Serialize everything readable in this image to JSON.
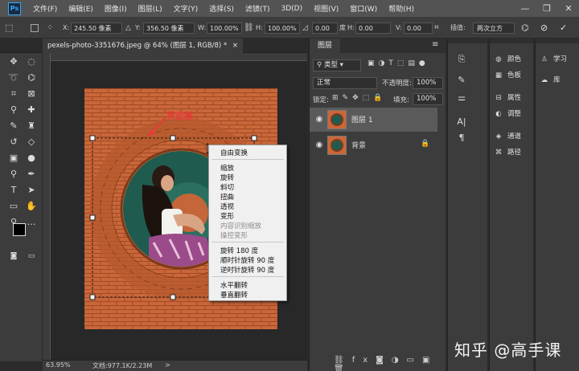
{
  "app": {
    "logo": "Ps"
  },
  "menubar": {
    "items": [
      "文件(F)",
      "编辑(E)",
      "图像(I)",
      "图层(L)",
      "文字(Y)",
      "选择(S)",
      "滤镜(T)",
      "3D(D)",
      "视图(V)",
      "窗口(W)",
      "帮助(H)"
    ],
    "min_icon": "minimize-icon",
    "max_icon": "maximize-icon",
    "close_icon": "close-icon"
  },
  "options_bar": {
    "x_label": "X:",
    "x_value": "245.50 像素",
    "y_label": "Y:",
    "y_value": "356.50 像素",
    "w_label": "W:",
    "w_value": "100.00%",
    "h_label": "H:",
    "h_value": "100.00%",
    "rot_value": "0.00",
    "rot_unit": "度",
    "hskew_label": "H:",
    "hskew_value": "0.00",
    "vskew_label": "V:",
    "vskew_value": "0.00",
    "interp_label": "插值:",
    "interp_value": "两次立方"
  },
  "document": {
    "tab_title": "pexels-photo-3351676.jpeg @ 64% (图层 1, RGB/8) *",
    "tab_close": "×",
    "annotation": "界定框"
  },
  "context_menu": {
    "groups": [
      [
        "自由变换"
      ],
      [
        "缩放",
        "旋转",
        "斜切",
        "扭曲",
        "透视",
        "变形"
      ],
      [
        "内容识别缩放",
        "操控变形"
      ],
      [
        "旋转 180 度",
        "顺时针旋转 90 度",
        "逆时针旋转 90 度"
      ],
      [
        "水平翻转",
        "垂直翻转"
      ]
    ],
    "disabled": [
      "内容识别缩放",
      "操控变形"
    ]
  },
  "status_bar": {
    "zoom": "63.95%",
    "doc_info": "文档:977.1K/2.23M",
    "arrow": ">"
  },
  "layers_panel": {
    "tab": "图层",
    "filter": "类型",
    "blend_mode": "正常",
    "opacity_label": "不透明度:",
    "opacity_value": "100%",
    "lock_label": "锁定:",
    "fill_label": "填充:",
    "fill_value": "100%",
    "layers": [
      {
        "name": "图层 1",
        "selected": true
      },
      {
        "name": "背景",
        "selected": false,
        "locked": true
      }
    ]
  },
  "right_panels": {
    "col2": [
      "颜色",
      "色板",
      "属性",
      "调整",
      "通道",
      "路径"
    ],
    "col3": [
      "学习",
      "库"
    ]
  },
  "watermark": "知乎 @高手课",
  "colors": {
    "accent": "#31a8ff",
    "bg_dark": "#2b2b2b",
    "panel": "#3c3c3c",
    "annotation": "#e83a3a"
  }
}
